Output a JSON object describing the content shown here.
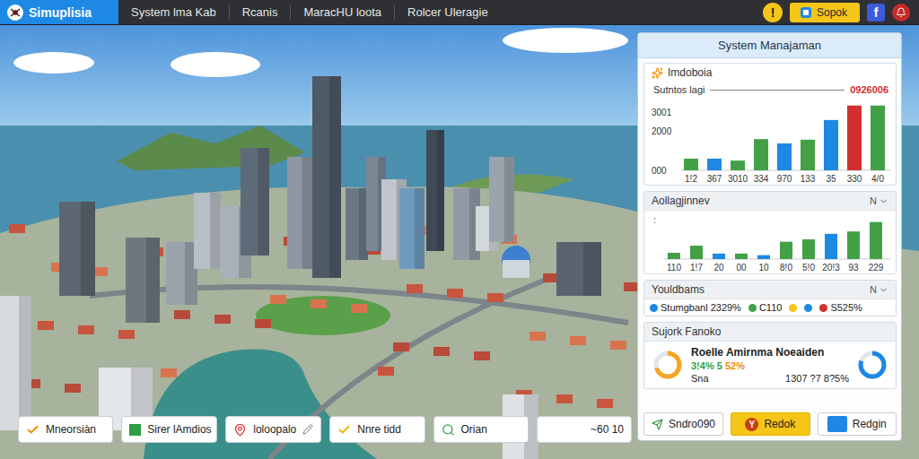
{
  "topbar": {
    "logo": "Simuplisia",
    "menu": [
      "System lma Kab",
      "Rcanis",
      "MaracHU loota",
      "Rolcer Uleragie"
    ],
    "alert": "!",
    "action": "Sopok",
    "social": "f"
  },
  "panel": {
    "title": "System Manajaman",
    "overview": {
      "title": "Imdoboia",
      "label": "Sutntos lagi",
      "total": "0926006",
      "max": 3400,
      "ticks": [
        {
          "label": "3001",
          "value": 3000
        },
        {
          "label": "2000",
          "value": 2000
        },
        {
          "label": "000",
          "value": 0
        }
      ],
      "bars": [
        {
          "x": "1!2",
          "value": 600,
          "color": "#43a047"
        },
        {
          "x": "367",
          "value": 600,
          "color": "#1e88e5"
        },
        {
          "x": "3010",
          "value": 500,
          "color": "#43a047"
        },
        {
          "x": "334",
          "value": 1600,
          "color": "#43a047"
        },
        {
          "x": "970",
          "value": 1380,
          "color": "#1e88e5"
        },
        {
          "x": "133",
          "value": 1570,
          "color": "#43a047"
        },
        {
          "x": "35",
          "value": 2580,
          "color": "#1e88e5"
        },
        {
          "x": "330",
          "value": 3320,
          "color": "#d32f2f"
        },
        {
          "x": "4/0",
          "value": 3320,
          "color": "#43a047"
        }
      ]
    },
    "activity": {
      "title": "Aollagjinnev",
      "toggle": "N",
      "axis_mark": ":",
      "max": 50,
      "bars": [
        {
          "x": "110",
          "value": 8,
          "color": "#43a047"
        },
        {
          "x": "1!7",
          "value": 17,
          "color": "#43a047"
        },
        {
          "x": "20",
          "value": 7,
          "color": "#1e88e5"
        },
        {
          "x": "00",
          "value": 7,
          "color": "#43a047"
        },
        {
          "x": "10",
          "value": 5,
          "color": "#1e88e5"
        },
        {
          "x": "8!0",
          "value": 22,
          "color": "#43a047"
        },
        {
          "x": "5!0",
          "value": 25,
          "color": "#43a047"
        },
        {
          "x": "20!3",
          "value": 32,
          "color": "#1e88e5"
        },
        {
          "x": "93",
          "value": 35,
          "color": "#43a047"
        },
        {
          "x": "229",
          "value": 47,
          "color": "#43a047"
        }
      ]
    },
    "legend": {
      "title": "Youldbams",
      "toggle": "N",
      "items": [
        {
          "kind": "labeled",
          "label": "Stumgbanl 2329%",
          "color": "#1e88e5"
        },
        {
          "kind": "labeled",
          "label": "C110",
          "color": "#43a047"
        },
        {
          "kind": "dot",
          "color": "#f5c518"
        },
        {
          "kind": "dot",
          "color": "#1e88e5"
        },
        {
          "kind": "labeled",
          "label": "S525%",
          "color": "#d32f2f"
        }
      ]
    },
    "summary": {
      "title": "Sujork Fanoko",
      "name": "Roelle Amirnma Noeaiden",
      "stat_a": "3!4% 5",
      "stat_b": "52%",
      "label": "Sna",
      "value": "1307 ?7 8?5%",
      "gauges": [
        {
          "level": 0.7,
          "color": "#f5a623"
        },
        {
          "level": 0.8,
          "color": "#1e88e5"
        }
      ]
    },
    "buttons": [
      {
        "label": "Sndro090",
        "kind": "plain"
      },
      {
        "label": "Redok",
        "kind": "yellow",
        "icon_text": "Y"
      },
      {
        "label": "Redgin",
        "kind": "blue"
      }
    ]
  },
  "toolbar": [
    {
      "label": "Mneorsiàn",
      "kind": "check",
      "color": "#f08c00"
    },
    {
      "label": "Sirer lAmdios",
      "kind": "square",
      "color": "#2f9e44"
    },
    {
      "label": "loloopalo",
      "kind": "pin",
      "color": "#e03131"
    },
    {
      "label": "Nnre tidd",
      "kind": "check",
      "color": "#f5b700"
    },
    {
      "label": "Orian",
      "kind": "search",
      "color": "#2f9e44"
    },
    {
      "label": "~60 10",
      "kind": "plain",
      "color": "#555555"
    }
  ]
}
